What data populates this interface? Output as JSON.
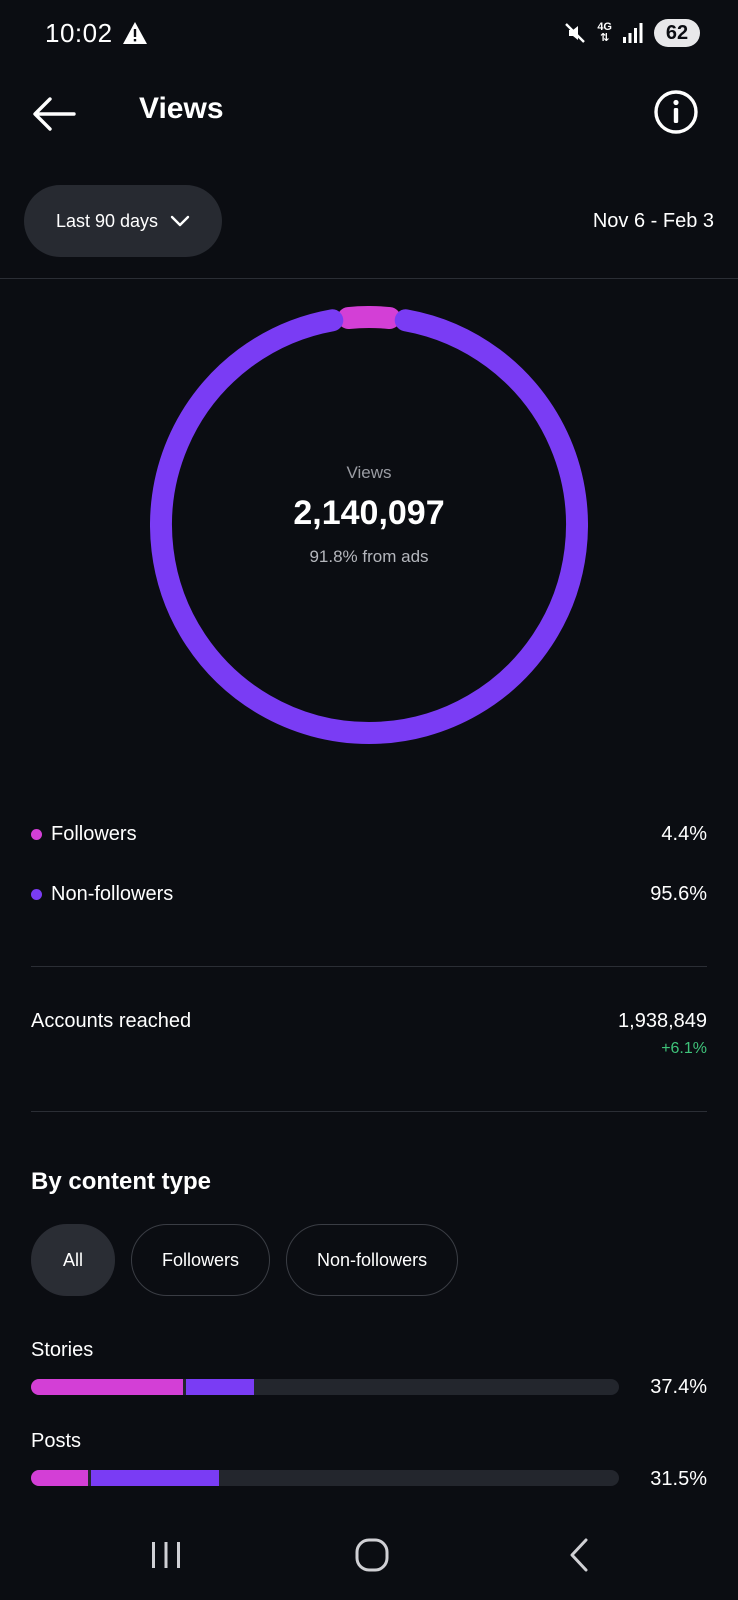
{
  "status_bar": {
    "time": "10:02",
    "network": "4G",
    "battery": "62"
  },
  "header": {
    "title": "Views"
  },
  "range": {
    "selector_label": "Last 90 days",
    "dates": "Nov 6 - Feb 3"
  },
  "summary": {
    "label": "Views",
    "total": "2,140,097",
    "ads_note": "91.8% from ads"
  },
  "chart_data": {
    "type": "pie",
    "categories": [
      "Followers",
      "Non-followers"
    ],
    "values": [
      4.4,
      95.6
    ],
    "colors": [
      "#d33fd6",
      "#7a3cf4"
    ]
  },
  "breakdown": [
    {
      "label": "Followers",
      "value": "4.4%",
      "color": "#d33fd6"
    },
    {
      "label": "Non-followers",
      "value": "95.6%",
      "color": "#7a3cf4"
    }
  ],
  "reach": {
    "label": "Accounts reached",
    "value": "1,938,849",
    "change": "+6.1%"
  },
  "content_type": {
    "title": "By content type",
    "filters": [
      "All",
      "Followers",
      "Non-followers"
    ],
    "active_filter": "All",
    "rows": [
      {
        "label": "Stories",
        "value": "37.4%",
        "followers_fraction": 0.258,
        "non_followers_fraction": 0.116
      },
      {
        "label": "Posts",
        "value": "31.5%",
        "followers_fraction": 0.097,
        "non_followers_fraction": 0.218
      }
    ]
  },
  "colors": {
    "accent_followers": "#d33fd6",
    "accent_non_followers": "#7a3cf4",
    "positive": "#3fc37a",
    "background": "#0b0d12"
  }
}
